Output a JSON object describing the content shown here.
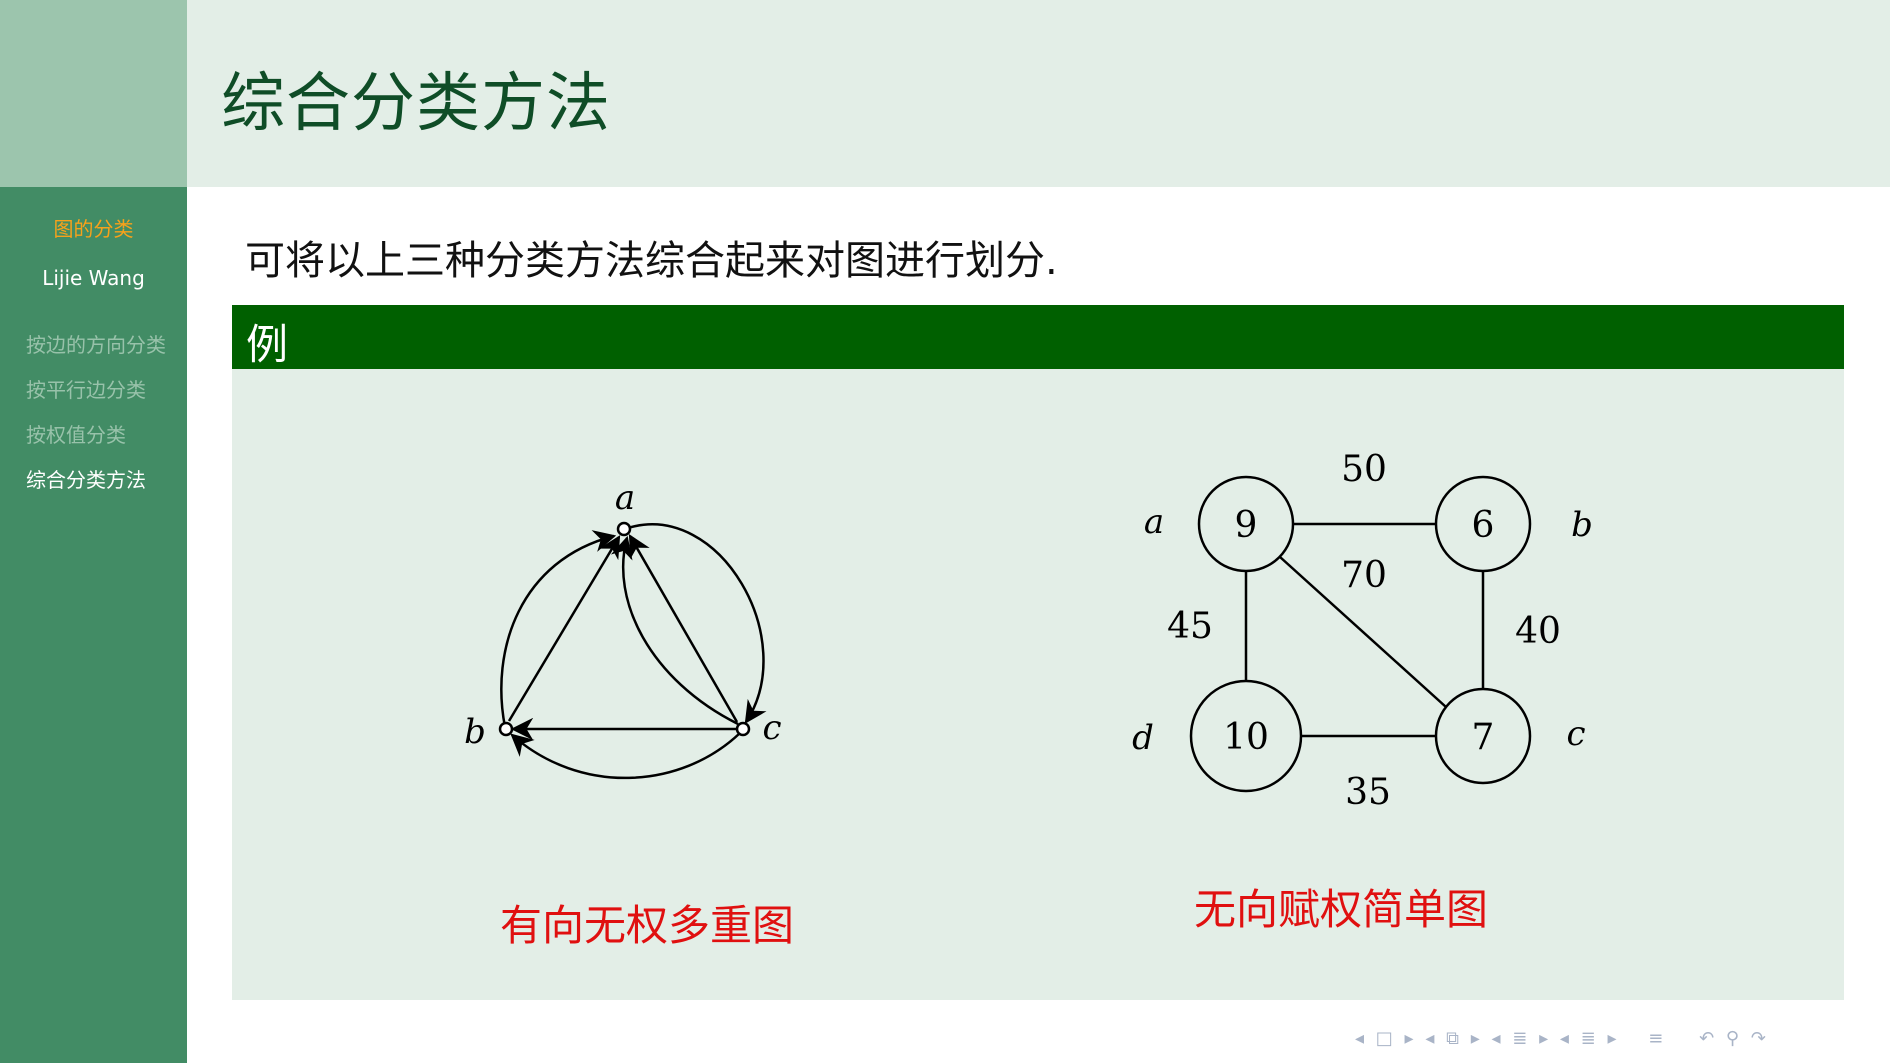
{
  "header": {
    "title": "综合分类方法"
  },
  "sidebar": {
    "section": "图的分类",
    "author": "Lijie Wang",
    "items": [
      {
        "label": "按边的方向分类",
        "active": false
      },
      {
        "label": "按平行边分类",
        "active": false
      },
      {
        "label": "按权值分类",
        "active": false
      },
      {
        "label": "综合分类方法",
        "active": true
      }
    ]
  },
  "content": {
    "intro": "可将以上三种分类方法综合起来对图进行划分.",
    "example_title": "例"
  },
  "graph1": {
    "caption": "有向无权多重图",
    "nodes": {
      "a": "a",
      "b": "b",
      "c": "c"
    }
  },
  "graph2": {
    "caption": "无向赋权简单图",
    "vertices": [
      {
        "label": "a",
        "value": "9"
      },
      {
        "label": "b",
        "value": "6"
      },
      {
        "label": "c",
        "value": "7"
      },
      {
        "label": "d",
        "value": "10"
      }
    ],
    "edges": [
      {
        "from": "a",
        "to": "b",
        "weight": "50"
      },
      {
        "from": "a",
        "to": "d",
        "weight": "45"
      },
      {
        "from": "a",
        "to": "c",
        "weight": "70"
      },
      {
        "from": "b",
        "to": "c",
        "weight": "40"
      },
      {
        "from": "d",
        "to": "c",
        "weight": "35"
      }
    ]
  },
  "colors": {
    "sidebar": "#428c65",
    "header_bg": "#e3eee7",
    "title": "#0f4d27",
    "block_header": "#006000",
    "caption": "#e01010",
    "section_highlight": "#f7a21b"
  },
  "nav_icons": [
    "nav-prev-frame-icon",
    "nav-frame-icon",
    "nav-next-frame-icon",
    "nav-prev-subsection-icon",
    "nav-subsection-icon",
    "nav-next-subsection-icon",
    "nav-prev-section-icon",
    "nav-section-icon",
    "nav-next-section-icon",
    "nav-document-icon",
    "nav-undo-icon",
    "nav-search-icon",
    "nav-redo-icon"
  ]
}
